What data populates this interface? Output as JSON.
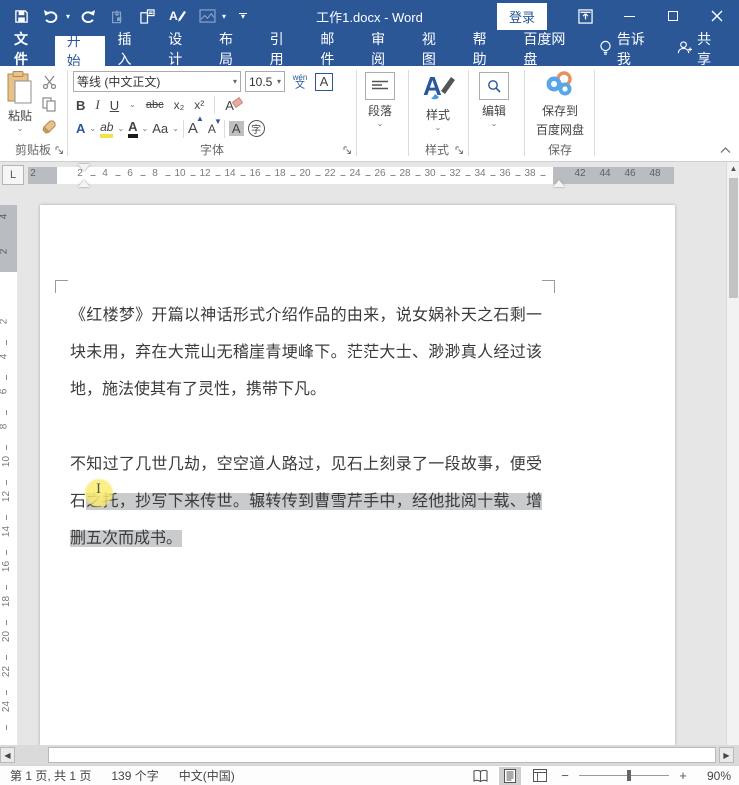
{
  "titlebar": {
    "title": "工作1.docx  -  Word",
    "signin_label": "登录",
    "qat_icons": [
      "save-icon",
      "undo-icon",
      "redo-icon",
      "document-lock-icon",
      "new-comment-icon",
      "font-edit-icon",
      "picture-icon",
      "customize-qat-icon"
    ]
  },
  "tabs": {
    "items": [
      "文件",
      "开始",
      "插入",
      "设计",
      "布局",
      "引用",
      "邮件",
      "审阅",
      "视图",
      "帮助",
      "百度网盘"
    ],
    "active": "开始",
    "tellme": "告诉我",
    "share": "共享"
  },
  "ribbon": {
    "clipboard": {
      "paste": "粘贴",
      "label": "剪贴板"
    },
    "font": {
      "name": "等线 (中文正文)",
      "size": "10.5",
      "label": "字体",
      "bold": "B",
      "italic": "I",
      "underline": "U",
      "strike": "abc",
      "subscript": "x₂",
      "superscript": "x²",
      "clear": "A",
      "effects": "A",
      "highlight": "ab",
      "color": "A",
      "case": "Aa",
      "grow": "A",
      "shrink": "A",
      "shade": "A",
      "enclose": "字",
      "phonetic_top": "wén",
      "phonetic_bottom": "文",
      "border": "A"
    },
    "paragraph": {
      "label": "段落"
    },
    "styles": {
      "button": "样式",
      "label": "样式"
    },
    "editing": {
      "label": "编辑"
    },
    "save": {
      "line1": "保存到",
      "line2": "百度网盘",
      "label": "保存"
    }
  },
  "ruler": {
    "h_left": [
      "2"
    ],
    "h_white": [
      "2",
      "4",
      "6",
      "8",
      "10",
      "12",
      "14",
      "16",
      "18",
      "20",
      "22",
      "24",
      "26",
      "28",
      "30",
      "32",
      "34",
      "36",
      "38"
    ],
    "h_right": [
      "42",
      "44",
      "46",
      "48"
    ],
    "v_gray": [
      "4",
      "2"
    ],
    "v_white": [
      "2",
      "4",
      "6",
      "8",
      "10",
      "12",
      "14",
      "16",
      "18",
      "20",
      "22",
      "24"
    ],
    "tab_selector": "L"
  },
  "document": {
    "paragraphs": [
      {
        "lines": [
          {
            "pre": "《红楼梦》开篇以神话形式介绍作品的由来，说女娲补天之石剩一",
            "sel": "",
            "short": false
          },
          {
            "pre": "块未用，弃在大荒山无稽崖青埂峰下。茫茫大士、渺渺真人经过该",
            "sel": "",
            "short": false
          },
          {
            "pre": "地，施法使其有了灵性，携带下凡。",
            "sel": "",
            "short": true
          }
        ]
      },
      {
        "lines": [
          {
            "pre": "不知过了几世几劫，空空道人路过，见石上刻录了一段故事，便受",
            "sel": "",
            "short": false
          },
          {
            "pre": "石",
            "sel": "之托，抄写下来传世。辗转传到曹雪芹手中，经他批阅十载、增",
            "short": false
          },
          {
            "pre": "",
            "sel": "删五次而成书。",
            "short": true
          }
        ]
      }
    ]
  },
  "statusbar": {
    "page": "第 1 页, 共 1 页",
    "words": "139 个字",
    "lang": "中文(中国)",
    "zoom": "90%"
  }
}
